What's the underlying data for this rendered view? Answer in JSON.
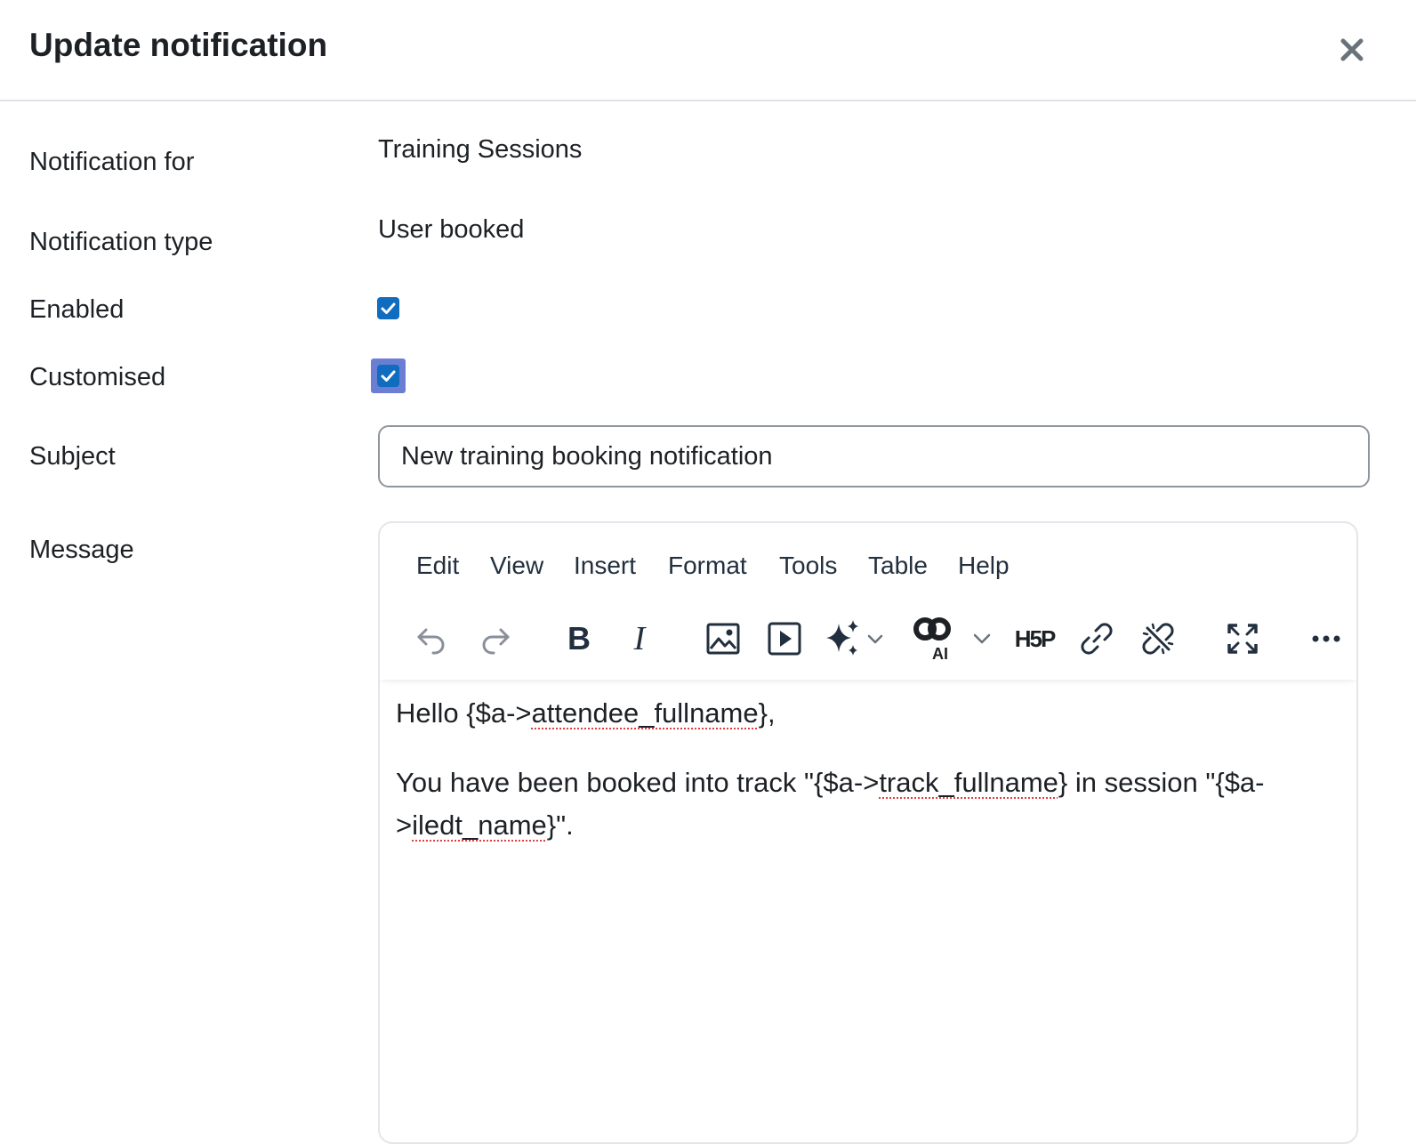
{
  "modal": {
    "title": "Update notification"
  },
  "form": {
    "notification_for": {
      "label": "Notification for",
      "value": "Training Sessions"
    },
    "notification_type": {
      "label": "Notification type",
      "value": "User booked"
    },
    "enabled": {
      "label": "Enabled",
      "checked": true
    },
    "customised": {
      "label": "Customised",
      "checked": true
    },
    "subject": {
      "label": "Subject",
      "value": "New training booking notification"
    },
    "message": {
      "label": "Message"
    }
  },
  "editor": {
    "menu": [
      "Edit",
      "View",
      "Insert",
      "Format",
      "Tools",
      "Table",
      "Help"
    ],
    "toolbar_icons": [
      "undo-icon",
      "redo-icon",
      "bold-icon",
      "italic-icon",
      "image-icon",
      "media-icon",
      "ai-sparkle-icon",
      "ai-generator-icon",
      "h5p-icon",
      "link-icon",
      "unlink-icon",
      "fullscreen-icon",
      "more-icon"
    ],
    "toolbar_text": {
      "bold": "B",
      "italic": "I",
      "ai": "AI",
      "h5p": "H5P"
    },
    "content": {
      "line1_prefix": "Hello {$a->",
      "line1_var": "attendee_fullname",
      "line1_suffix": "},",
      "line2_prefix": "You have been booked into track \"{$a->",
      "line2_var1": "track_fullname",
      "line2_mid": "} in session \"{$a->",
      "line2_var2": "iledt_name",
      "line2_suffix": "}\"."
    }
  },
  "colors": {
    "checkbox": "#0f6cbf",
    "focus_ring": "#6a7fd4",
    "spellcheck": "#e03e3e"
  }
}
